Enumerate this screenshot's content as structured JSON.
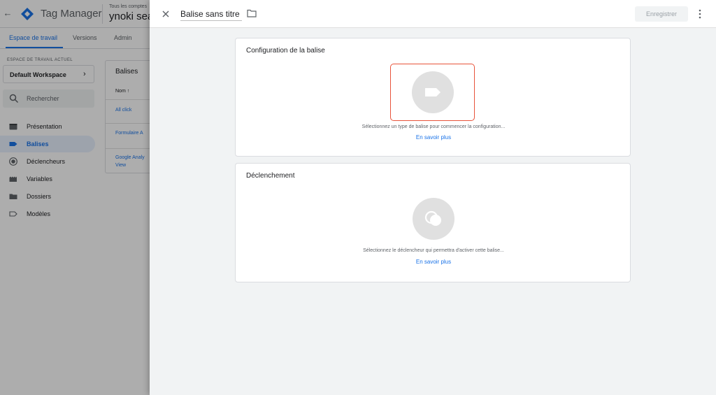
{
  "app": {
    "name": "Tag Manager",
    "account_label": "Tous les comptes",
    "account_name": "ynoki sea"
  },
  "tabs": [
    {
      "label": "Espace de travail"
    },
    {
      "label": "Versions"
    },
    {
      "label": "Admin"
    }
  ],
  "sidebar": {
    "workspace_label": "ESPACE DE TRAVAIL ACTUEL",
    "workspace_name": "Default Workspace",
    "search_placeholder": "Rechercher",
    "items": [
      {
        "label": "Présentation",
        "icon": "overview-icon"
      },
      {
        "label": "Balises",
        "icon": "tag-icon"
      },
      {
        "label": "Déclencheurs",
        "icon": "trigger-icon"
      },
      {
        "label": "Variables",
        "icon": "variables-icon"
      },
      {
        "label": "Dossiers",
        "icon": "folder-icon"
      },
      {
        "label": "Modèles",
        "icon": "template-icon"
      }
    ]
  },
  "tags_list": {
    "title": "Balises",
    "column": "Nom ↑",
    "rows": [
      "All click",
      "Formulaire A",
      "Google Analy",
      "View"
    ]
  },
  "panel": {
    "title": "Balise sans titre",
    "save_label": "Enregistrer",
    "config_card": {
      "title": "Configuration de la balise",
      "hint": "Sélectionnez un type de balise pour commencer la configuration...",
      "link": "En savoir plus"
    },
    "trigger_card": {
      "title": "Déclenchement",
      "hint": "Sélectionnez le déclencheur qui permettra d'activer cette balise...",
      "link": "En savoir plus"
    }
  },
  "colors": {
    "accent": "#1a73e8",
    "selection_border": "#e8533a",
    "placeholder_circle": "#e0e0e0",
    "scrim": "rgba(0,0,0,0.32)"
  }
}
